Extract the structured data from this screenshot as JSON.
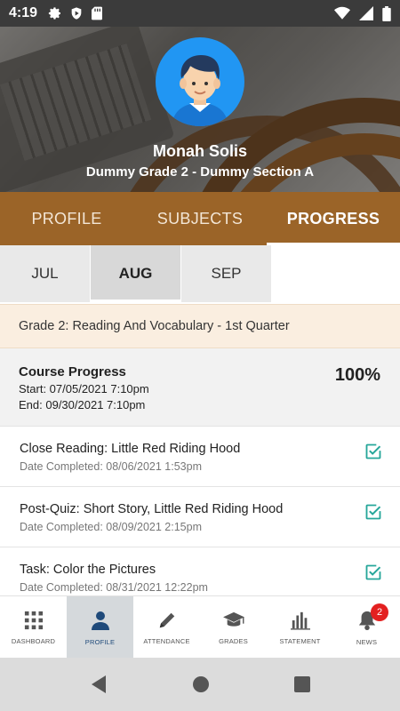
{
  "status_bar": {
    "time": "4:19",
    "icons_left": [
      "gear-icon",
      "play-protect-icon",
      "sd-card-icon"
    ],
    "icons_right": [
      "wifi-icon",
      "signal-icon",
      "battery-icon"
    ]
  },
  "header": {
    "student_name": "Monah  Solis",
    "section": "Dummy Grade 2 - Dummy Section A",
    "avatar_icon": "student-avatar-icon"
  },
  "main_tabs": [
    {
      "label": "PROFILE",
      "active": false
    },
    {
      "label": "SUBJECTS",
      "active": false
    },
    {
      "label": "PROGRESS",
      "active": true
    }
  ],
  "month_tabs": [
    {
      "label": "JUL",
      "active": false
    },
    {
      "label": "AUG",
      "active": true
    },
    {
      "label": "SEP",
      "active": false
    }
  ],
  "course": {
    "title": "Grade 2: Reading And Vocabulary - 1st Quarter",
    "progress_label": "Course Progress",
    "start": "Start: 07/05/2021 7:10pm",
    "end": "End: 09/30/2021 7:10pm",
    "percent": "100%"
  },
  "items": [
    {
      "title": "Close Reading: Little Red Riding Hood",
      "date": "Date Completed: 08/06/2021 1:53pm",
      "completed": true
    },
    {
      "title": "Post-Quiz: Short Story, Little Red Riding Hood",
      "date": "Date Completed: 08/09/2021 2:15pm",
      "completed": true
    },
    {
      "title": "Task: Color the Pictures",
      "date": "Date Completed: 08/31/2021 12:22pm",
      "completed": true
    }
  ],
  "bottom_nav": [
    {
      "label": "DASHBOARD",
      "icon": "grid-icon",
      "active": false
    },
    {
      "label": "PROFILE",
      "icon": "person-icon",
      "active": true
    },
    {
      "label": "ATTENDANCE",
      "icon": "pencil-icon",
      "active": false
    },
    {
      "label": "GRADES",
      "icon": "graduation-cap-icon",
      "active": false
    },
    {
      "label": "STATEMENT",
      "icon": "bar-chart-icon",
      "active": false
    },
    {
      "label": "NEWS",
      "icon": "bell-icon",
      "active": false,
      "badge": "2"
    }
  ],
  "colors": {
    "accent_brown": "#9b6428",
    "avatar_blue": "#2196f3",
    "check_teal": "#26a69a",
    "badge_red": "#e32020"
  }
}
